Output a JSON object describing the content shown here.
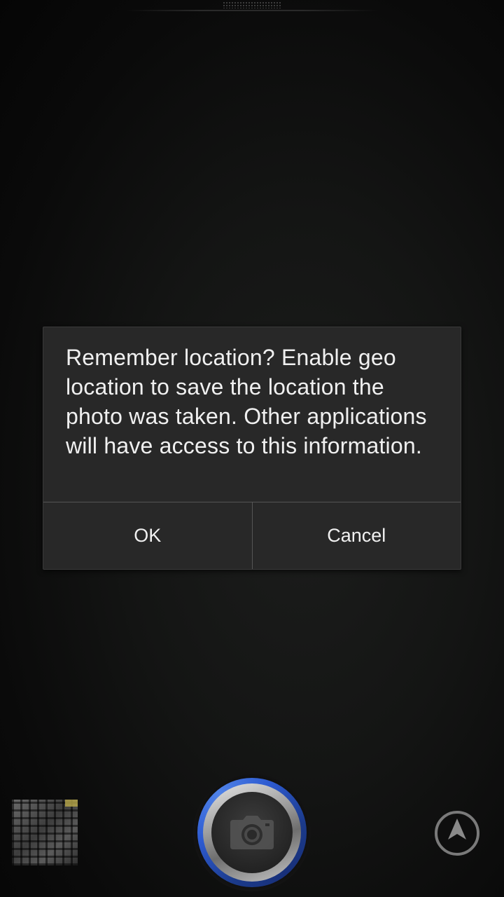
{
  "dialog": {
    "message": "Remember location? Enable geo location to save the location the photo was taken. Other applications will have access to this information.",
    "ok_label": "OK",
    "cancel_label": "Cancel"
  },
  "controls": {
    "thumbnail_icon": "last-photo-thumbnail",
    "shutter_icon": "camera-icon",
    "location_icon": "navigation-arrow-icon"
  },
  "colors": {
    "dialog_bg": "#282828",
    "shutter_ring": "#2d5ad0",
    "text": "#f0f0f0"
  }
}
